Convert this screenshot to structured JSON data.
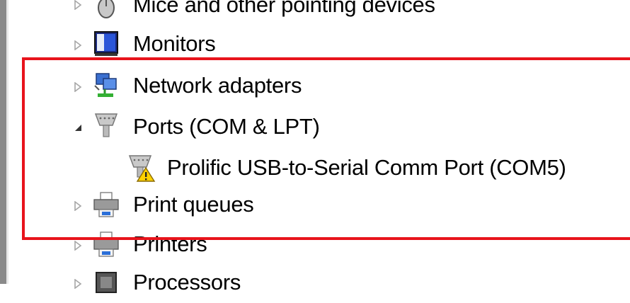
{
  "device_tree": {
    "items": [
      {
        "label": "Mice and other pointing devices",
        "state": "collapsed",
        "icon": "mouse-icon"
      },
      {
        "label": "Monitors",
        "state": "collapsed",
        "icon": "monitor-icon"
      },
      {
        "label": "Network adapters",
        "state": "collapsed",
        "icon": "network-adapter-icon"
      },
      {
        "label": "Ports (COM & LPT)",
        "state": "expanded",
        "icon": "port-icon"
      },
      {
        "label": "Prolific USB-to-Serial Comm Port (COM5)",
        "state": "warning",
        "icon": "port-warning-icon"
      },
      {
        "label": "Print queues",
        "state": "collapsed",
        "icon": "printer-icon"
      },
      {
        "label": "Printers",
        "state": "collapsed",
        "icon": "printer-icon"
      },
      {
        "label": "Processors",
        "state": "collapsed",
        "icon": "processor-icon"
      }
    ]
  },
  "highlight": {
    "color": "#e8141c"
  }
}
